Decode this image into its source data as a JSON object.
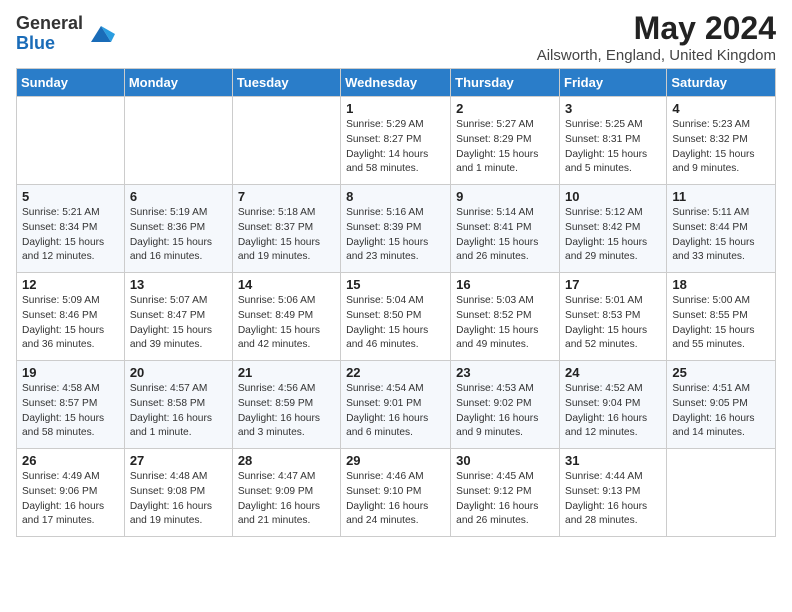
{
  "logo": {
    "general": "General",
    "blue": "Blue"
  },
  "title": "May 2024",
  "subtitle": "Ailsworth, England, United Kingdom",
  "days_of_week": [
    "Sunday",
    "Monday",
    "Tuesday",
    "Wednesday",
    "Thursday",
    "Friday",
    "Saturday"
  ],
  "weeks": [
    [
      {
        "day": "",
        "info": ""
      },
      {
        "day": "",
        "info": ""
      },
      {
        "day": "",
        "info": ""
      },
      {
        "day": "1",
        "info": "Sunrise: 5:29 AM\nSunset: 8:27 PM\nDaylight: 14 hours and 58 minutes."
      },
      {
        "day": "2",
        "info": "Sunrise: 5:27 AM\nSunset: 8:29 PM\nDaylight: 15 hours and 1 minute."
      },
      {
        "day": "3",
        "info": "Sunrise: 5:25 AM\nSunset: 8:31 PM\nDaylight: 15 hours and 5 minutes."
      },
      {
        "day": "4",
        "info": "Sunrise: 5:23 AM\nSunset: 8:32 PM\nDaylight: 15 hours and 9 minutes."
      }
    ],
    [
      {
        "day": "5",
        "info": "Sunrise: 5:21 AM\nSunset: 8:34 PM\nDaylight: 15 hours and 12 minutes."
      },
      {
        "day": "6",
        "info": "Sunrise: 5:19 AM\nSunset: 8:36 PM\nDaylight: 15 hours and 16 minutes."
      },
      {
        "day": "7",
        "info": "Sunrise: 5:18 AM\nSunset: 8:37 PM\nDaylight: 15 hours and 19 minutes."
      },
      {
        "day": "8",
        "info": "Sunrise: 5:16 AM\nSunset: 8:39 PM\nDaylight: 15 hours and 23 minutes."
      },
      {
        "day": "9",
        "info": "Sunrise: 5:14 AM\nSunset: 8:41 PM\nDaylight: 15 hours and 26 minutes."
      },
      {
        "day": "10",
        "info": "Sunrise: 5:12 AM\nSunset: 8:42 PM\nDaylight: 15 hours and 29 minutes."
      },
      {
        "day": "11",
        "info": "Sunrise: 5:11 AM\nSunset: 8:44 PM\nDaylight: 15 hours and 33 minutes."
      }
    ],
    [
      {
        "day": "12",
        "info": "Sunrise: 5:09 AM\nSunset: 8:46 PM\nDaylight: 15 hours and 36 minutes."
      },
      {
        "day": "13",
        "info": "Sunrise: 5:07 AM\nSunset: 8:47 PM\nDaylight: 15 hours and 39 minutes."
      },
      {
        "day": "14",
        "info": "Sunrise: 5:06 AM\nSunset: 8:49 PM\nDaylight: 15 hours and 42 minutes."
      },
      {
        "day": "15",
        "info": "Sunrise: 5:04 AM\nSunset: 8:50 PM\nDaylight: 15 hours and 46 minutes."
      },
      {
        "day": "16",
        "info": "Sunrise: 5:03 AM\nSunset: 8:52 PM\nDaylight: 15 hours and 49 minutes."
      },
      {
        "day": "17",
        "info": "Sunrise: 5:01 AM\nSunset: 8:53 PM\nDaylight: 15 hours and 52 minutes."
      },
      {
        "day": "18",
        "info": "Sunrise: 5:00 AM\nSunset: 8:55 PM\nDaylight: 15 hours and 55 minutes."
      }
    ],
    [
      {
        "day": "19",
        "info": "Sunrise: 4:58 AM\nSunset: 8:57 PM\nDaylight: 15 hours and 58 minutes."
      },
      {
        "day": "20",
        "info": "Sunrise: 4:57 AM\nSunset: 8:58 PM\nDaylight: 16 hours and 1 minute."
      },
      {
        "day": "21",
        "info": "Sunrise: 4:56 AM\nSunset: 8:59 PM\nDaylight: 16 hours and 3 minutes."
      },
      {
        "day": "22",
        "info": "Sunrise: 4:54 AM\nSunset: 9:01 PM\nDaylight: 16 hours and 6 minutes."
      },
      {
        "day": "23",
        "info": "Sunrise: 4:53 AM\nSunset: 9:02 PM\nDaylight: 16 hours and 9 minutes."
      },
      {
        "day": "24",
        "info": "Sunrise: 4:52 AM\nSunset: 9:04 PM\nDaylight: 16 hours and 12 minutes."
      },
      {
        "day": "25",
        "info": "Sunrise: 4:51 AM\nSunset: 9:05 PM\nDaylight: 16 hours and 14 minutes."
      }
    ],
    [
      {
        "day": "26",
        "info": "Sunrise: 4:49 AM\nSunset: 9:06 PM\nDaylight: 16 hours and 17 minutes."
      },
      {
        "day": "27",
        "info": "Sunrise: 4:48 AM\nSunset: 9:08 PM\nDaylight: 16 hours and 19 minutes."
      },
      {
        "day": "28",
        "info": "Sunrise: 4:47 AM\nSunset: 9:09 PM\nDaylight: 16 hours and 21 minutes."
      },
      {
        "day": "29",
        "info": "Sunrise: 4:46 AM\nSunset: 9:10 PM\nDaylight: 16 hours and 24 minutes."
      },
      {
        "day": "30",
        "info": "Sunrise: 4:45 AM\nSunset: 9:12 PM\nDaylight: 16 hours and 26 minutes."
      },
      {
        "day": "31",
        "info": "Sunrise: 4:44 AM\nSunset: 9:13 PM\nDaylight: 16 hours and 28 minutes."
      },
      {
        "day": "",
        "info": ""
      }
    ]
  ]
}
